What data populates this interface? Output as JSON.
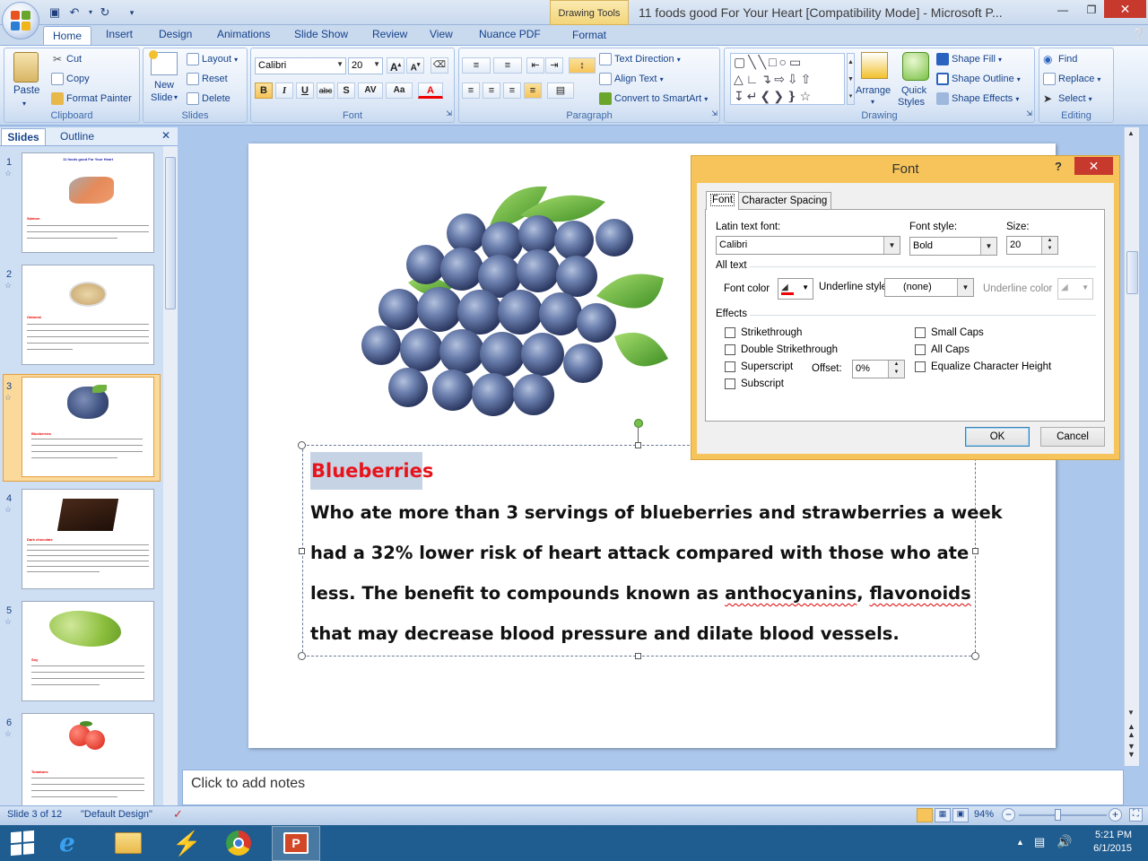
{
  "titlebar": {
    "drawing_tools_label": "Drawing Tools",
    "app_title": "11 foods good For Your Heart [Compatibility Mode] - Microsoft P..."
  },
  "tabs": [
    "Home",
    "Insert",
    "Design",
    "Animations",
    "Slide Show",
    "Review",
    "View",
    "Nuance PDF",
    "Format"
  ],
  "ribbon": {
    "clipboard": {
      "label": "Clipboard",
      "paste": "Paste",
      "cut": "Cut",
      "copy": "Copy",
      "format_painter": "Format Painter"
    },
    "slides": {
      "label": "Slides",
      "new_slide_1": "New",
      "new_slide_2": "Slide",
      "layout": "Layout",
      "reset": "Reset",
      "delete": "Delete"
    },
    "font": {
      "label": "Font",
      "font_name": "Calibri",
      "font_size": "20"
    },
    "paragraph": {
      "label": "Paragraph",
      "text_direction": "Text Direction",
      "align_text": "Align Text",
      "convert_smartart": "Convert to SmartArt"
    },
    "drawing": {
      "label": "Drawing",
      "arrange": "Arrange",
      "quick_styles_1": "Quick",
      "quick_styles_2": "Styles",
      "shape_fill": "Shape Fill",
      "shape_outline": "Shape Outline",
      "shape_effects": "Shape Effects"
    },
    "editing": {
      "label": "Editing",
      "find": "Find",
      "replace": "Replace",
      "select": "Select"
    }
  },
  "left_pane": {
    "tab_slides": "Slides",
    "tab_outline": "Outline",
    "thumbnails": [
      {
        "num": "1",
        "title": "11 foods good For Your Heart",
        "food": "Salmon"
      },
      {
        "num": "2",
        "food": "Oatmeal"
      },
      {
        "num": "3",
        "food": "Blueberries"
      },
      {
        "num": "4",
        "food": "Dark chocolate"
      },
      {
        "num": "5",
        "food": "Soy"
      },
      {
        "num": "6",
        "food": "Tomatoes"
      }
    ]
  },
  "slide": {
    "heading": "Blueberries",
    "lines": [
      "Who ate more than 3 servings of blueberries and strawberries a week",
      "had a 32% lower risk of heart attack compared with those who ate",
      "that may decrease blood pressure and dilate blood vessels."
    ],
    "line3_a": "less. The benefit to compounds known as ",
    "line3_b": "anthocyanins",
    "line3_c": ", ",
    "line3_d": "flavonoids"
  },
  "notes_placeholder": "Click to add notes",
  "dialog": {
    "title": "Font",
    "help": "?",
    "tab_font": "Font",
    "tab_char_spacing": "Character Spacing",
    "latin_font_label": "Latin text font:",
    "latin_font_value": "Calibri",
    "font_style_label": "Font style:",
    "font_style_value": "Bold",
    "size_label": "Size:",
    "size_value": "20",
    "all_text_label": "All text",
    "font_color_label": "Font color",
    "underline_style_label": "Underline style",
    "underline_style_value": "(none)",
    "underline_color_label": "Underline color",
    "effects_label": "Effects",
    "strikethrough": "Strikethrough",
    "double_strikethrough": "Double Strikethrough",
    "superscript": "Superscript",
    "subscript": "Subscript",
    "offset_label": "Offset:",
    "offset_value": "0%",
    "small_caps": "Small Caps",
    "all_caps": "All Caps",
    "equalize_height": "Equalize Character Height",
    "ok": "OK",
    "cancel": "Cancel"
  },
  "status": {
    "slide_info": "Slide 3 of 12",
    "theme": "\"Default Design\"",
    "zoom": "94%"
  },
  "taskbar": {
    "time": "5:21 PM",
    "date": "6/1/2015"
  }
}
